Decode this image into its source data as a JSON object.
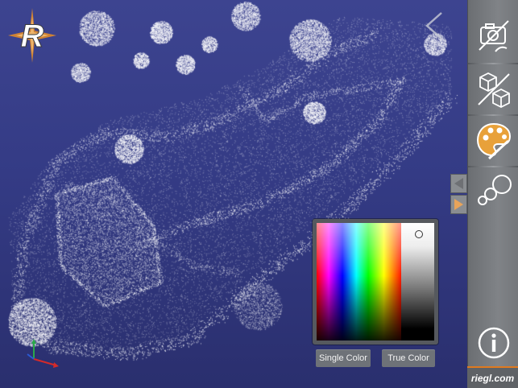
{
  "app": {
    "brand_text": "riegl.com",
    "logo_letter": "R"
  },
  "viewer": {
    "background_top": "#3d4490",
    "background_bottom": "#2a2f6e",
    "point_color": "#ffffff"
  },
  "color_picker": {
    "single_color_label": "Single Color",
    "true_color_label": "True Color"
  },
  "toolbar": {
    "items": [
      {
        "icon": "camera-icon",
        "label": ""
      },
      {
        "icon": "cube-view-icon",
        "label": ""
      },
      {
        "icon": "palette-icon",
        "label": ""
      },
      {
        "icon": "point-size-icon",
        "label": ""
      },
      {
        "icon": "info-icon",
        "label": ""
      }
    ],
    "accent": "#e07a1f"
  }
}
